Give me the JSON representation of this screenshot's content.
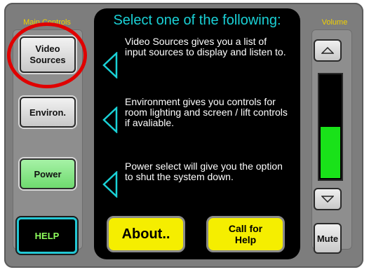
{
  "left_sidebar": {
    "title": "Main Controls",
    "buttons": [
      {
        "label_line1": "Video",
        "label_line2": "Sources"
      },
      {
        "label": "Environ."
      },
      {
        "label": "Power"
      },
      {
        "label": "HELP"
      }
    ]
  },
  "center": {
    "title": "Select one of the following:",
    "items": [
      {
        "text": "Video Sources gives you a list of input sources to display and listen to."
      },
      {
        "text": "Environment gives you controls for room lighting and screen / lift controls if avaliable."
      },
      {
        "text": "Power select will give you the option to shut the system down."
      }
    ],
    "about_label": "About..",
    "call_help_line1": "Call for",
    "call_help_line2": "Help"
  },
  "volume": {
    "title": "Volume",
    "level_fraction": 0.5,
    "mute_label": "Mute"
  },
  "colors": {
    "accent_cyan": "#1ad1d6",
    "highlight_yellow": "#f5ee00",
    "meter_green": "#19e219",
    "annotation_red": "#e00000"
  },
  "icons": {
    "volume_up": "triangle-up-icon",
    "volume_down": "triangle-down-icon",
    "pointer": "triangle-left-icon"
  }
}
